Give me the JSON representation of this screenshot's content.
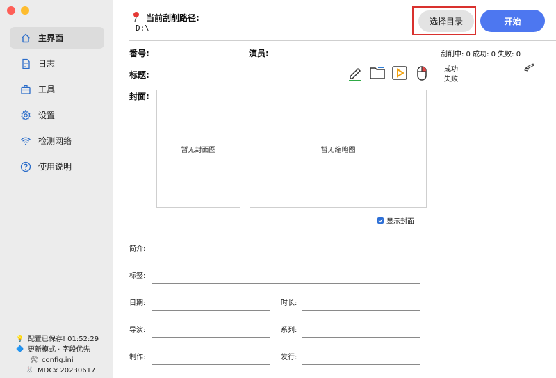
{
  "sidebar": {
    "items": [
      {
        "label": "主界面",
        "icon": "home-icon",
        "active": true
      },
      {
        "label": "日志",
        "icon": "document-icon",
        "active": false
      },
      {
        "label": "工具",
        "icon": "toolbox-icon",
        "active": false
      },
      {
        "label": "设置",
        "icon": "gear-icon",
        "active": false
      },
      {
        "label": "检测网络",
        "icon": "wifi-icon",
        "active": false
      },
      {
        "label": "使用说明",
        "icon": "help-icon",
        "active": false
      }
    ],
    "status": {
      "saved_icon": "💡",
      "saved": "配置已保存! 01:52:29",
      "mode_icon": "🔷",
      "mode": "更新模式 · 字段优先",
      "config_icon": "🛠",
      "config": "config.ini",
      "version_icon": "🐰",
      "version": "MDCx 20230617"
    }
  },
  "header": {
    "path_label": "当前刮削路径:",
    "path_value": "D:\\",
    "select_button": "选择目录",
    "start_button": "开始"
  },
  "info": {
    "number_label": "番号:",
    "actor_label": "演员:",
    "title_label": "标题:",
    "cover_label": "封面:",
    "counters": "刮削中: 0 成功: 0 失败: 0",
    "success_label": "成功",
    "fail_label": "失败"
  },
  "images": {
    "no_cover": "暂无封面图",
    "no_thumb": "暂无缩略图",
    "show_cover": "显示封面"
  },
  "fields": {
    "intro": "简介:",
    "tags": "标签:",
    "date": "日期:",
    "duration": "时长:",
    "director": "导演:",
    "series": "系列:",
    "studio": "制作:",
    "publisher": "发行:"
  }
}
